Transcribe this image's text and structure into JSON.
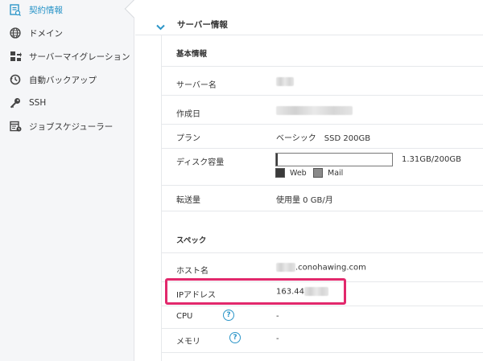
{
  "sidebar": {
    "items": [
      {
        "label": "契約情報",
        "icon": "contract-document-icon",
        "active": true
      },
      {
        "label": "ドメイン",
        "icon": "globe-icon",
        "active": false
      },
      {
        "label": "サーバーマイグレーション",
        "icon": "server-migration-icon",
        "active": false
      },
      {
        "label": "自動バックアップ",
        "icon": "backup-clock-icon",
        "active": false
      },
      {
        "label": "SSH",
        "icon": "key-icon",
        "active": false
      },
      {
        "label": "ジョブスケジューラー",
        "icon": "job-scheduler-icon",
        "active": false
      }
    ],
    "accent_color": "#2b95c8"
  },
  "section": {
    "title": "サーバー情報",
    "expanded": true
  },
  "basic_info": {
    "title": "基本情報",
    "rows": {
      "server_name": {
        "label": "サーバー名"
      },
      "created_date": {
        "label": "作成日"
      },
      "plan": {
        "label": "プラン",
        "value": "ベーシック　SSD 200GB"
      },
      "disk": {
        "label": "ディスク容量",
        "usage_text": "1.31GB/200GB",
        "used_fraction": 0.0066,
        "legend_web": "Web",
        "legend_mail": "Mail",
        "web_color": "#3a3a3a",
        "mail_color": "#8a8a8a"
      },
      "transfer": {
        "label": "転送量",
        "value": "使用量 0 GB/月"
      }
    }
  },
  "spec": {
    "title": "スペック",
    "rows": {
      "host": {
        "label": "ホスト名",
        "value_suffix": ".conohawing.com"
      },
      "ip": {
        "label": "IPアドレス",
        "value_prefix": "163.44"
      },
      "cpu": {
        "label": "CPU",
        "value": "-",
        "help": "?"
      },
      "memory": {
        "label": "メモリ",
        "value": "-",
        "help": "?"
      }
    }
  },
  "highlight_color": "#e2286c"
}
